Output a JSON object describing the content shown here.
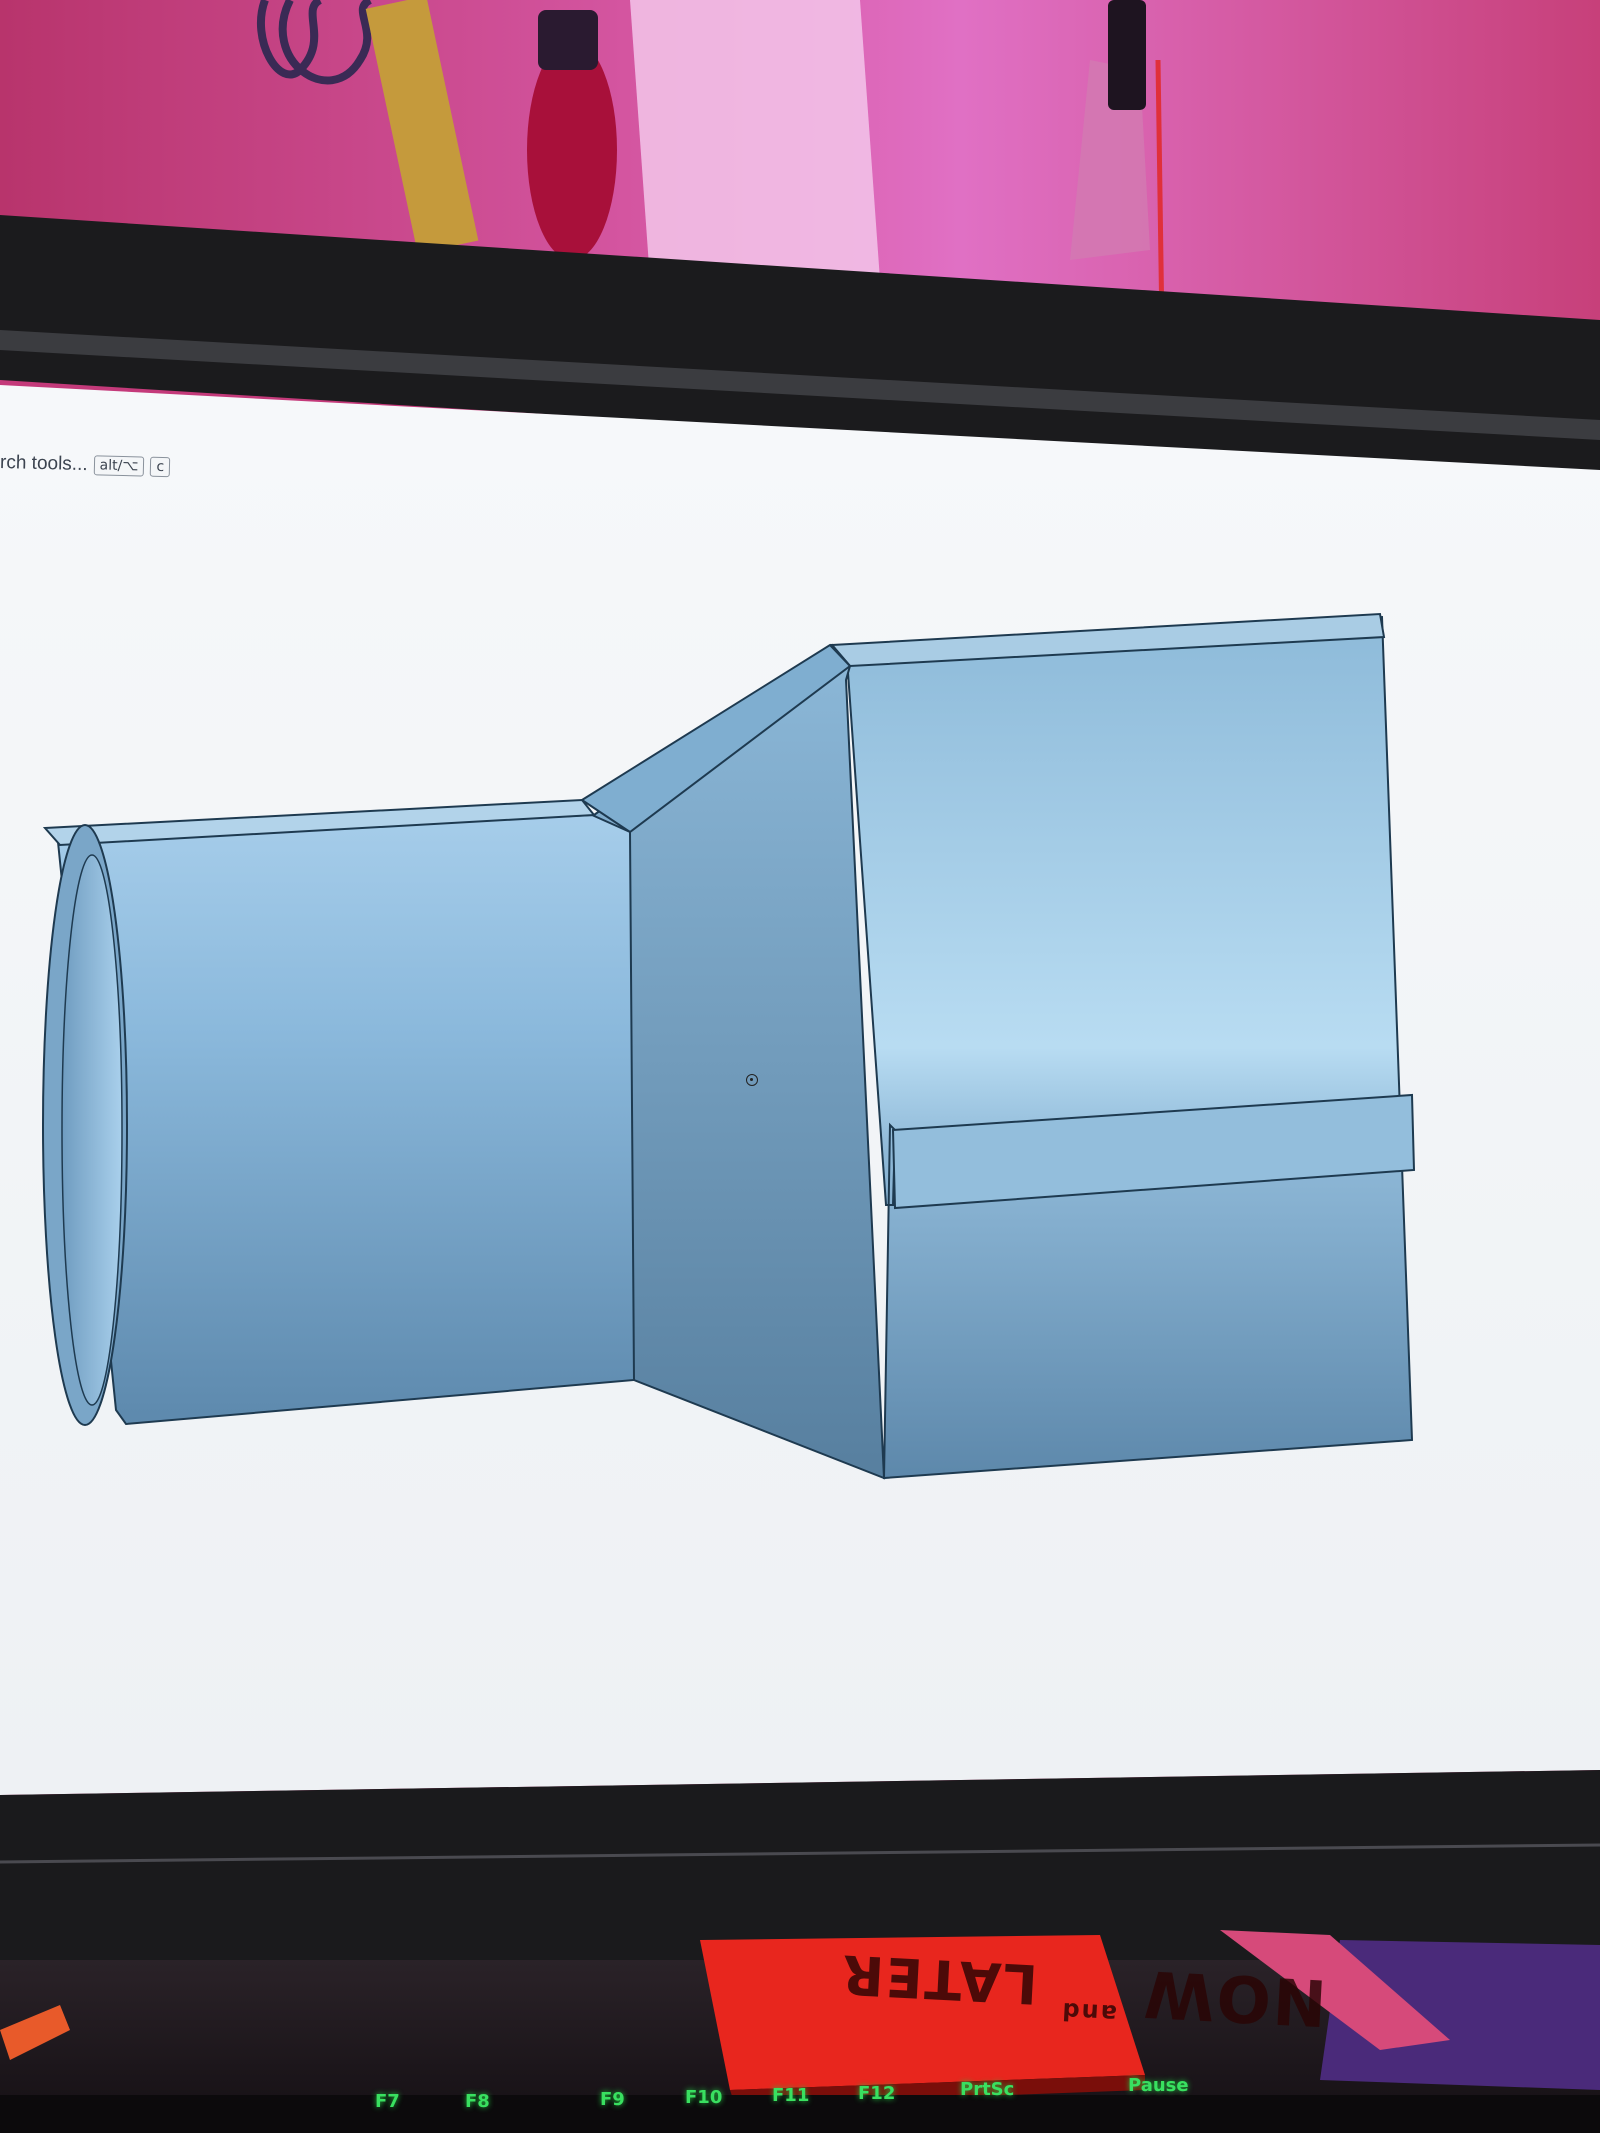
{
  "screen": {
    "search_hint_text": "rch tools...",
    "search_hint_key1": "alt/⌥",
    "search_hint_key2": "c"
  },
  "keyboard": {
    "keys": [
      "F7",
      "F8",
      "F9",
      "F10",
      "F11",
      "F12",
      "PrtSc",
      "Pause"
    ]
  },
  "card": {
    "text_main": "NOW",
    "text_small": "and",
    "text_top": "LATER"
  },
  "colors": {
    "wall": "#c43a7a",
    "model_body": "#8ab6d6",
    "model_edge": "#1e3a50",
    "viewport_bg": "#f2f4f6",
    "key_glow": "#39e060",
    "card_red": "#e8261e"
  }
}
